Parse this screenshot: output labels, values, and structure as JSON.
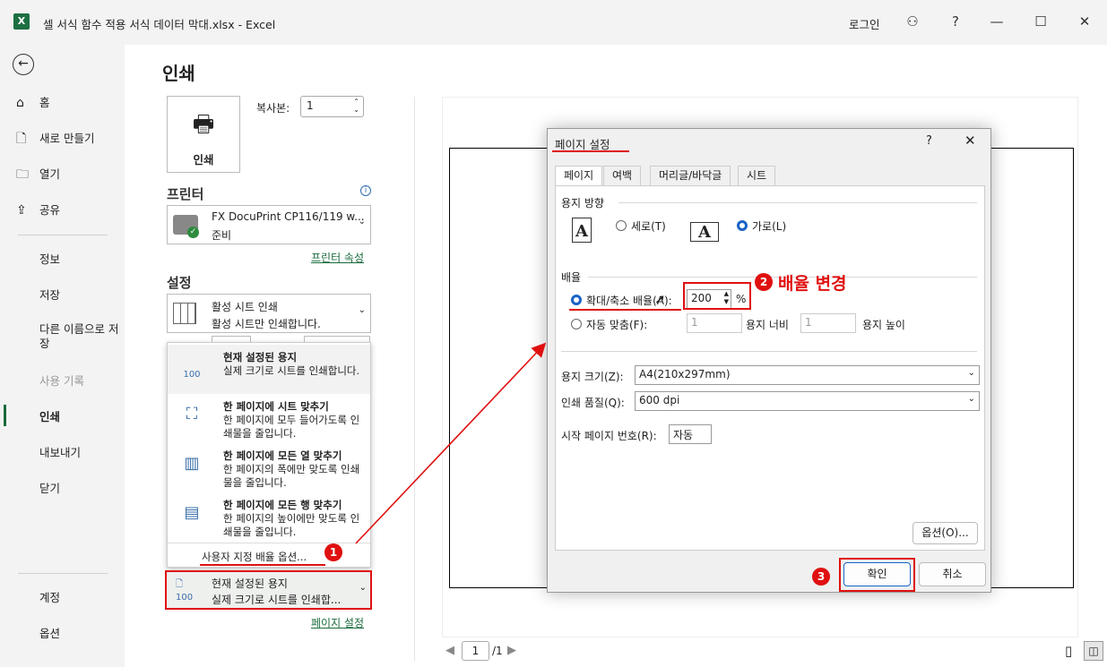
{
  "window": {
    "title": "셀 서식 함수 적용 서식 데이터 막대.xlsx  -  Excel",
    "app_icon": "excel-icon",
    "login": "로그인",
    "help": "?"
  },
  "sidebar": {
    "items": [
      "홈",
      "새로 만들기",
      "열기",
      "공유"
    ],
    "items2": [
      "정보",
      "저장",
      "다른 이름으로 저장",
      "사용 기록",
      "인쇄",
      "내보내기",
      "닫기"
    ],
    "items3": [
      "계정",
      "옵션"
    ],
    "active": "인쇄"
  },
  "print": {
    "title": "인쇄",
    "button": "인쇄",
    "copies_label": "복사본:",
    "copies_value": "1",
    "printer_heading": "프린터",
    "printer_name": "FX DocuPrint CP116/119 w...",
    "printer_status": "준비",
    "printer_props": "프린터 속성",
    "settings_heading": "설정",
    "sheet_dd_title": "활성 시트 인쇄",
    "sheet_dd_desc": "활성 시트만 인쇄합니다.",
    "scale_options": [
      {
        "title": "현재 설정된 용지",
        "desc": "실제 크기로 시트를 인쇄합니다.",
        "icon": "100"
      },
      {
        "title": "한 페이지에 시트 맞추기",
        "desc": "한 페이지에 모두 들어가도록 인쇄물을 줄입니다."
      },
      {
        "title": "한 페이지에 모든 열 맞추기",
        "desc": "한 페이지의 폭에만 맞도록 인쇄물을 줄입니다."
      },
      {
        "title": "한 페이지에 모든 행 맞추기",
        "desc": "한 페이지의 높이에만 맞도록 인쇄물을 줄입니다."
      }
    ],
    "custom_scale": "사용자 지정 배율 옵션...",
    "current_title": "현재 설정된 용지",
    "current_desc": "실제 크기로 시트를 인쇄합...",
    "page_setup_link": "페이지 설정",
    "page_num": "1",
    "page_total": "/1"
  },
  "dialog": {
    "title": "페이지 설정",
    "help": "?",
    "tabs": [
      "페이지",
      "여백",
      "머리글/바닥글",
      "시트"
    ],
    "orientation_label": "용지 방향",
    "portrait": "세로(T)",
    "landscape": "가로(L)",
    "scale_label": "배율",
    "adjust_label": "확대/축소 배율(A):",
    "adjust_value": "200",
    "percent": "%",
    "fit_label": "자동 맞춤(F):",
    "fit_w": "1",
    "fit_w_label": "용지 너비",
    "fit_h": "1",
    "fit_h_label": "용지 높이",
    "paper_label": "용지 크기(Z):",
    "paper_value": "A4(210x297mm)",
    "quality_label": "인쇄 품질(Q):",
    "quality_value": "600 dpi",
    "first_page_label": "시작 페이지 번호(R):",
    "first_page_value": "자동",
    "options_btn": "옵션(O)...",
    "ok": "확인",
    "cancel": "취소"
  },
  "annotations": {
    "b1": "1",
    "b2": "2",
    "b2_text": "배율 변경",
    "b3": "3",
    "color": "#e01010"
  }
}
